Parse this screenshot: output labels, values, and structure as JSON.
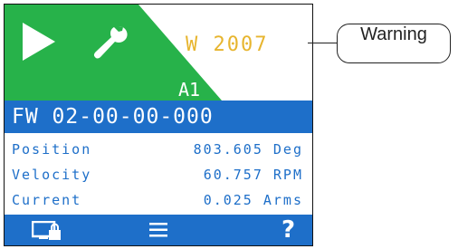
{
  "header": {
    "warning_code": "W 2007",
    "axis_label": "A1",
    "icons": [
      "play-icon",
      "wrench-icon"
    ]
  },
  "firmware": {
    "label": "FW 02-00-00-000"
  },
  "readouts": [
    {
      "label": "Position",
      "value": "803.605 Deg"
    },
    {
      "label": "Velocity",
      "value": "60.757 RPM"
    },
    {
      "label": "Current",
      "value": "0.025 Arms"
    }
  ],
  "bottom_bar": {
    "help": "?",
    "icons": [
      "monitor-lock-icon",
      "menu-icon",
      "help-icon"
    ]
  },
  "callout": {
    "label": "Warning"
  },
  "colors": {
    "status_green": "#27b24a",
    "warning_text": "#e7b52f",
    "primary_blue": "#1e6fc9"
  }
}
